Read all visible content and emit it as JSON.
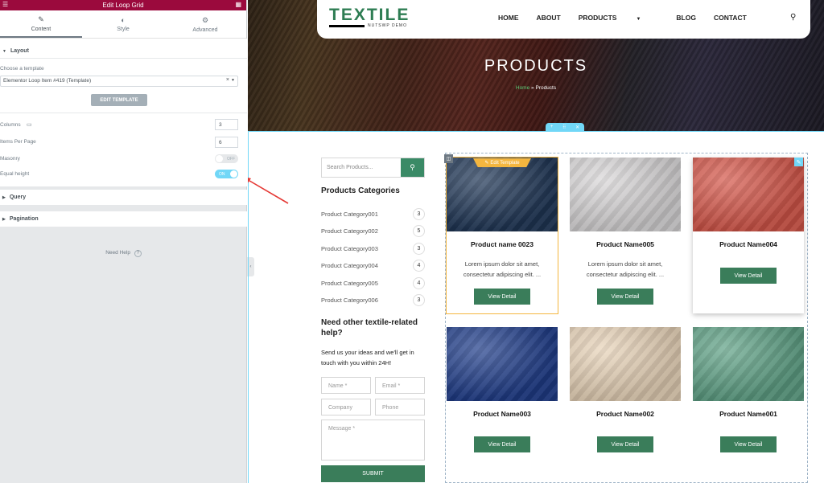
{
  "editor": {
    "title": "Edit Loop Grid",
    "tabs": [
      {
        "label": "Content",
        "icon": "pencil-icon"
      },
      {
        "label": "Style",
        "icon": "half-circle-icon"
      },
      {
        "label": "Advanced",
        "icon": "gear-icon"
      }
    ],
    "layout_section": "Layout",
    "template_label": "Choose a template",
    "template_value": "Elementor Loop Item #419 (Template)",
    "edit_template_button": "EDIT TEMPLATE",
    "columns_label": "Columns",
    "columns_value": "3",
    "items_per_page_label": "Items Per Page",
    "items_per_page_value": "6",
    "masonry_label": "Masonry",
    "masonry_value": "OFF",
    "equal_height_label": "Equal height",
    "equal_height_value": "ON",
    "query_section": "Query",
    "pagination_section": "Pagination",
    "need_help": "Need Help"
  },
  "site": {
    "logo": "TEXTILE",
    "logo_sub": "NUTSWP DEMO",
    "nav": [
      "HOME",
      "ABOUT",
      "PRODUCTS",
      "BLOG",
      "CONTACT"
    ],
    "hero_title": "PRODUCTS",
    "breadcrumb_home": "Home",
    "breadcrumb_sep": " » ",
    "breadcrumb_current": "Products",
    "search_placeholder": "Search Products...",
    "categories_title": "Products Categories",
    "categories": [
      {
        "name": "Product Category001",
        "count": "3"
      },
      {
        "name": "Product Category002",
        "count": "5"
      },
      {
        "name": "Product Category003",
        "count": "3"
      },
      {
        "name": "Product Category004",
        "count": "4"
      },
      {
        "name": "Product Category005",
        "count": "4"
      },
      {
        "name": "Product Category006",
        "count": "3"
      }
    ],
    "help_title": "Need other textile-related help?",
    "help_text": "Send us your ideas and we'll get in touch with you within 24H!",
    "form": {
      "name": "Name *",
      "email": "Email *",
      "company": "Company",
      "phone": "Phone",
      "message": "Message *",
      "submit": "SUBMIT"
    },
    "edit_template_badge": "Edit Template",
    "view_detail": "View Detail",
    "products": [
      {
        "name": "Product name 0023",
        "desc": "Lorem ipsum dolor sit amet, consectetur adipiscing elit. ...",
        "color": "#1f3656"
      },
      {
        "name": "Product Name005",
        "desc": "Lorem ipsum dolor sit amet, consectetur adipiscing elit. ...",
        "color": "#d9d7d8"
      },
      {
        "name": "Product Name004",
        "desc": "",
        "color": "#d6574a"
      },
      {
        "name": "Product Name003",
        "desc": "",
        "color": "#1f3d8a"
      },
      {
        "name": "Product Name002",
        "desc": "",
        "color": "#e8d3b8"
      },
      {
        "name": "Product Name001",
        "desc": "",
        "color": "#5fa286"
      }
    ]
  }
}
